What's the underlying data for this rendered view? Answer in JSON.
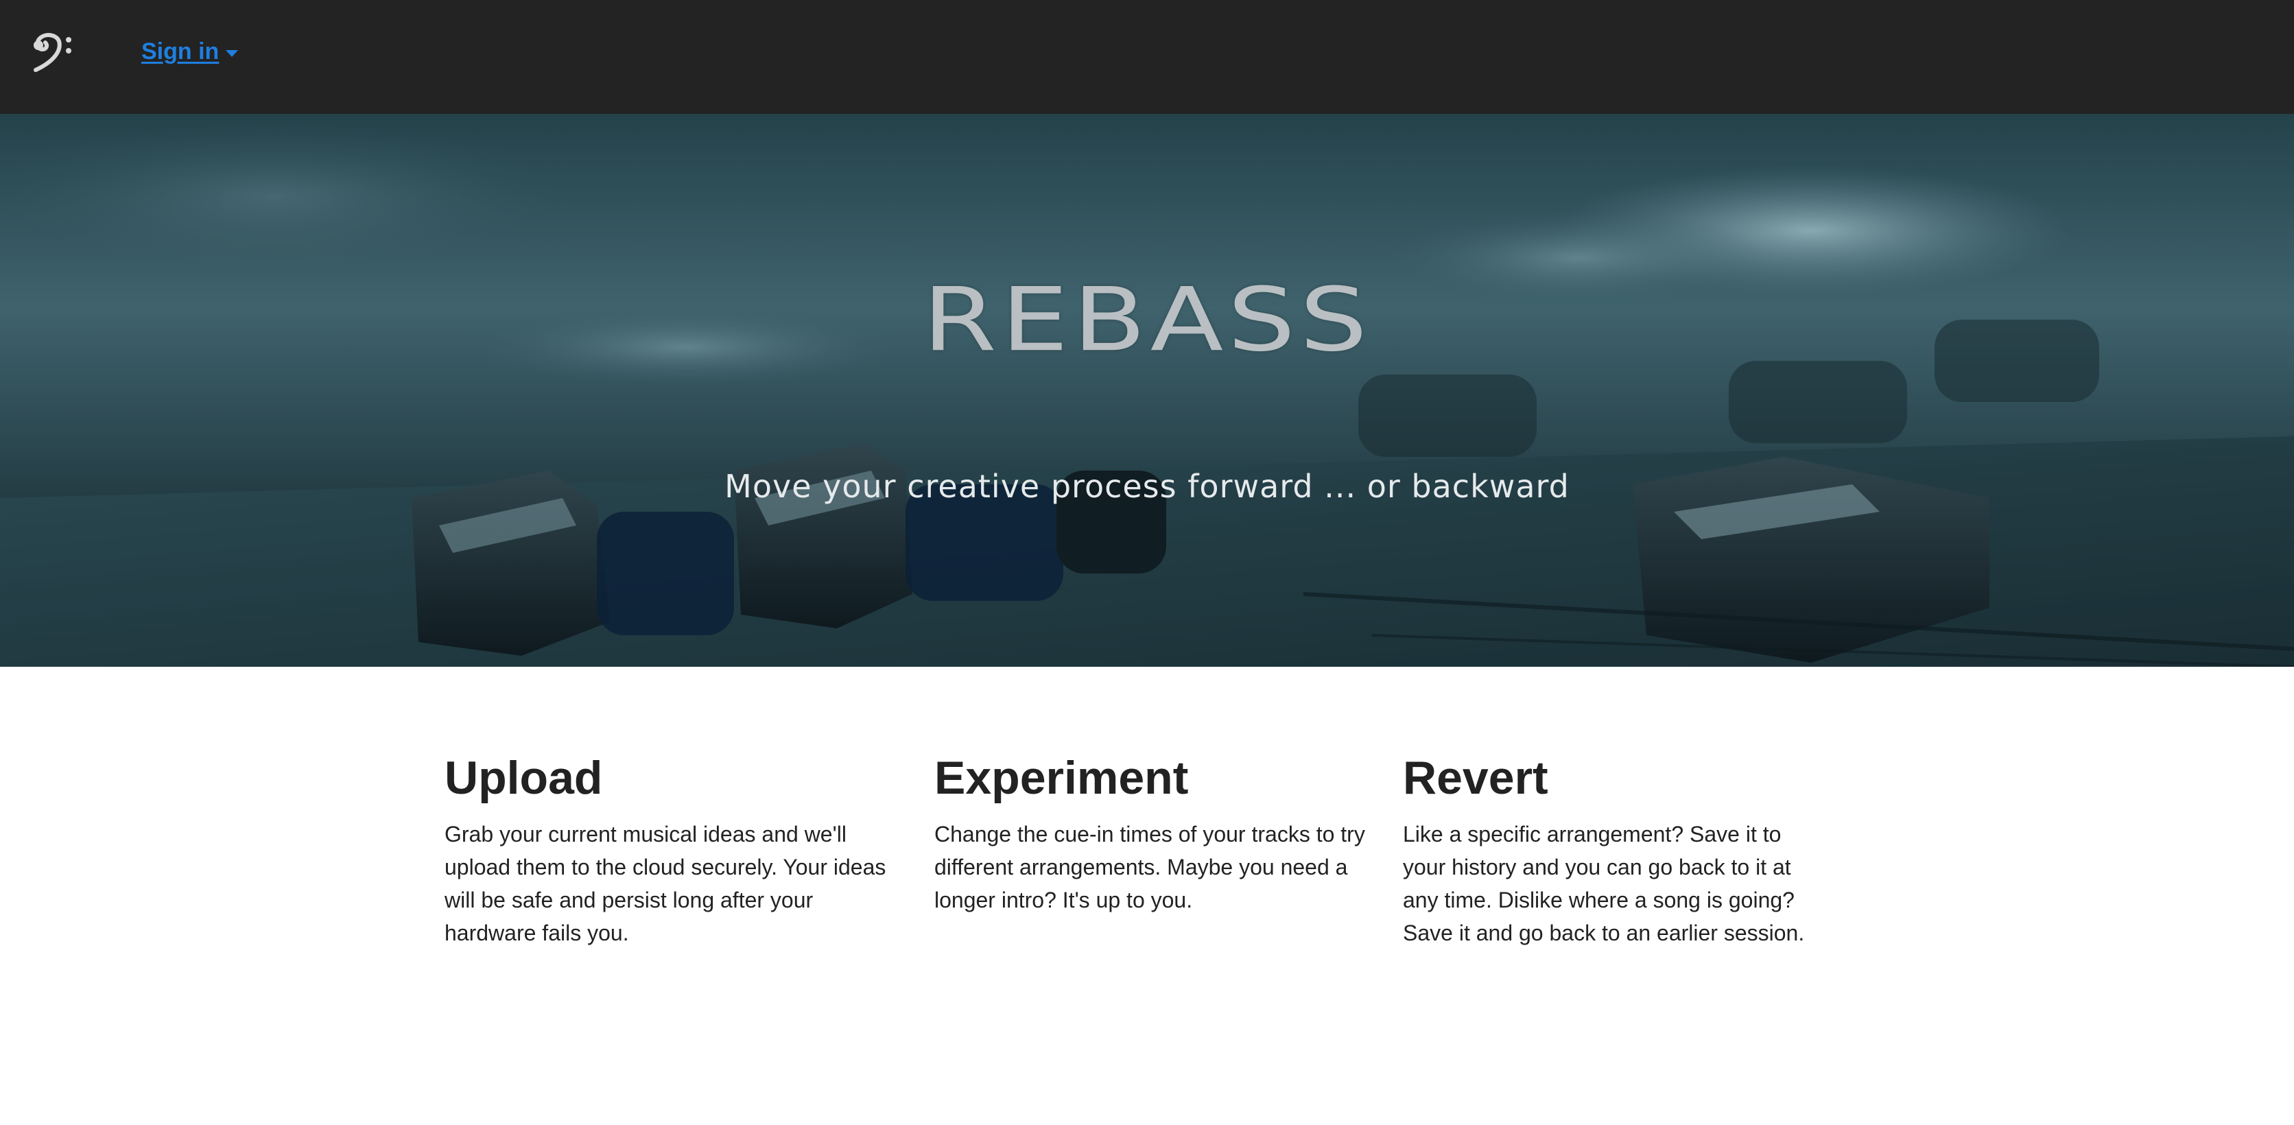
{
  "nav": {
    "logo_icon": "bass-clef-icon",
    "signin_label": "Sign in"
  },
  "hero": {
    "title": "REBASS",
    "subtitle": "Move your creative process forward ... or backward"
  },
  "features": [
    {
      "title": "Upload",
      "body": "Grab your current musical ideas and we'll upload them to the cloud securely. Your ideas will be safe and persist long after your hardware fails you."
    },
    {
      "title": "Experiment",
      "body": "Change the cue-in times of your tracks to try different arrangements. Maybe you need a longer intro? It's up to you."
    },
    {
      "title": "Revert",
      "body": "Like a specific arrangement? Save it to your history and you can go back to it at any time. Dislike where a song is going? Save it and go back to an earlier session."
    }
  ],
  "colors": {
    "navbar": "#232323",
    "link": "#1f7fe0",
    "text": "#222222"
  }
}
